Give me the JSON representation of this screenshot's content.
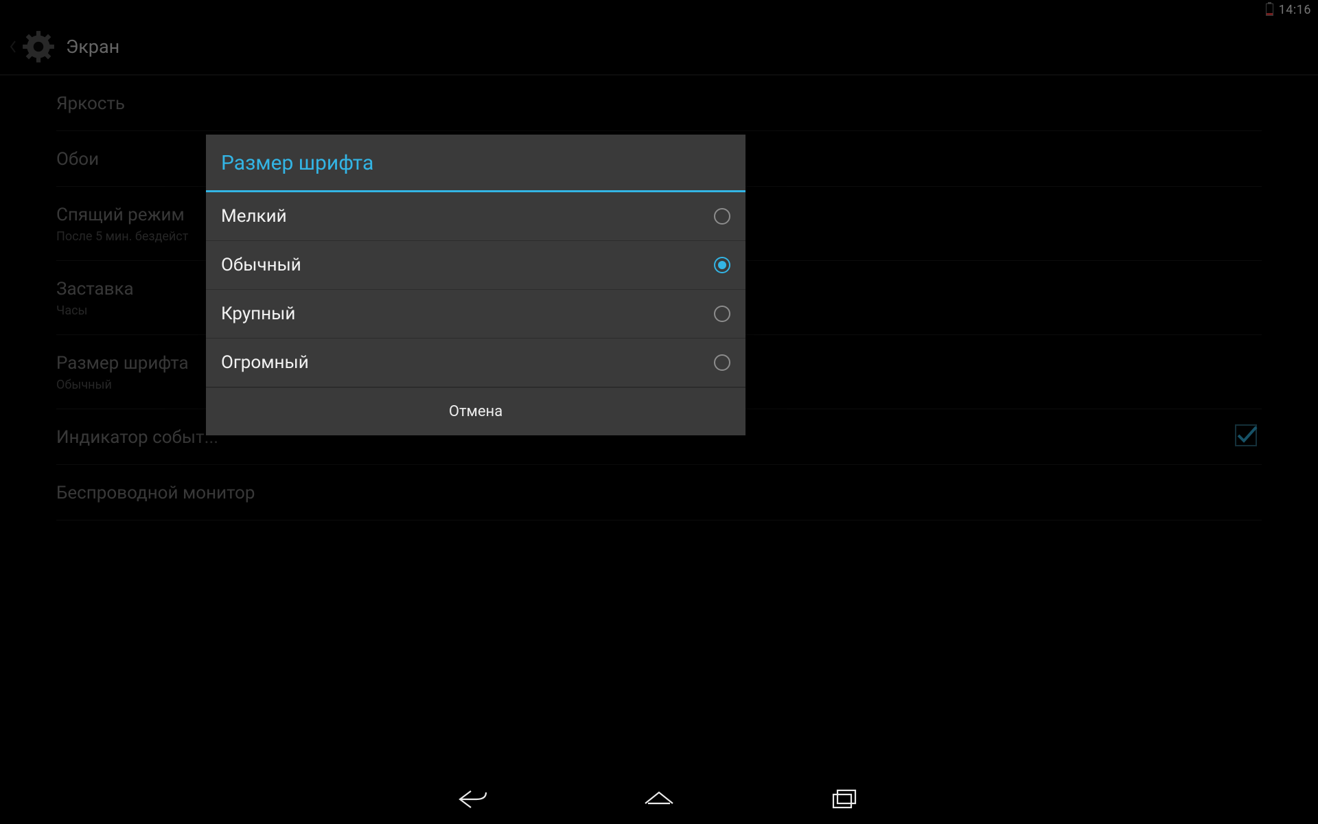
{
  "status": {
    "time": "14:16"
  },
  "actionbar": {
    "title": "Экран"
  },
  "settings": {
    "items": [
      {
        "title": "Яркость",
        "sub": ""
      },
      {
        "title": "Обои",
        "sub": ""
      },
      {
        "title": "Спящий режим",
        "sub": "После 5 мин. бездейст"
      },
      {
        "title": "Заставка",
        "sub": "Часы"
      },
      {
        "title": "Размер шрифта",
        "sub": "Обычный"
      },
      {
        "title": "Индикатор событ...",
        "sub": "",
        "checked": true
      },
      {
        "title": "Беспроводной монитор",
        "sub": ""
      }
    ]
  },
  "dialog": {
    "title": "Размер шрифта",
    "options": [
      {
        "label": "Мелкий",
        "selected": false
      },
      {
        "label": "Обычный",
        "selected": true
      },
      {
        "label": "Крупный",
        "selected": false
      },
      {
        "label": "Огромный",
        "selected": false
      }
    ],
    "cancel": "Отмена"
  },
  "colors": {
    "accent": "#33b5e5"
  }
}
